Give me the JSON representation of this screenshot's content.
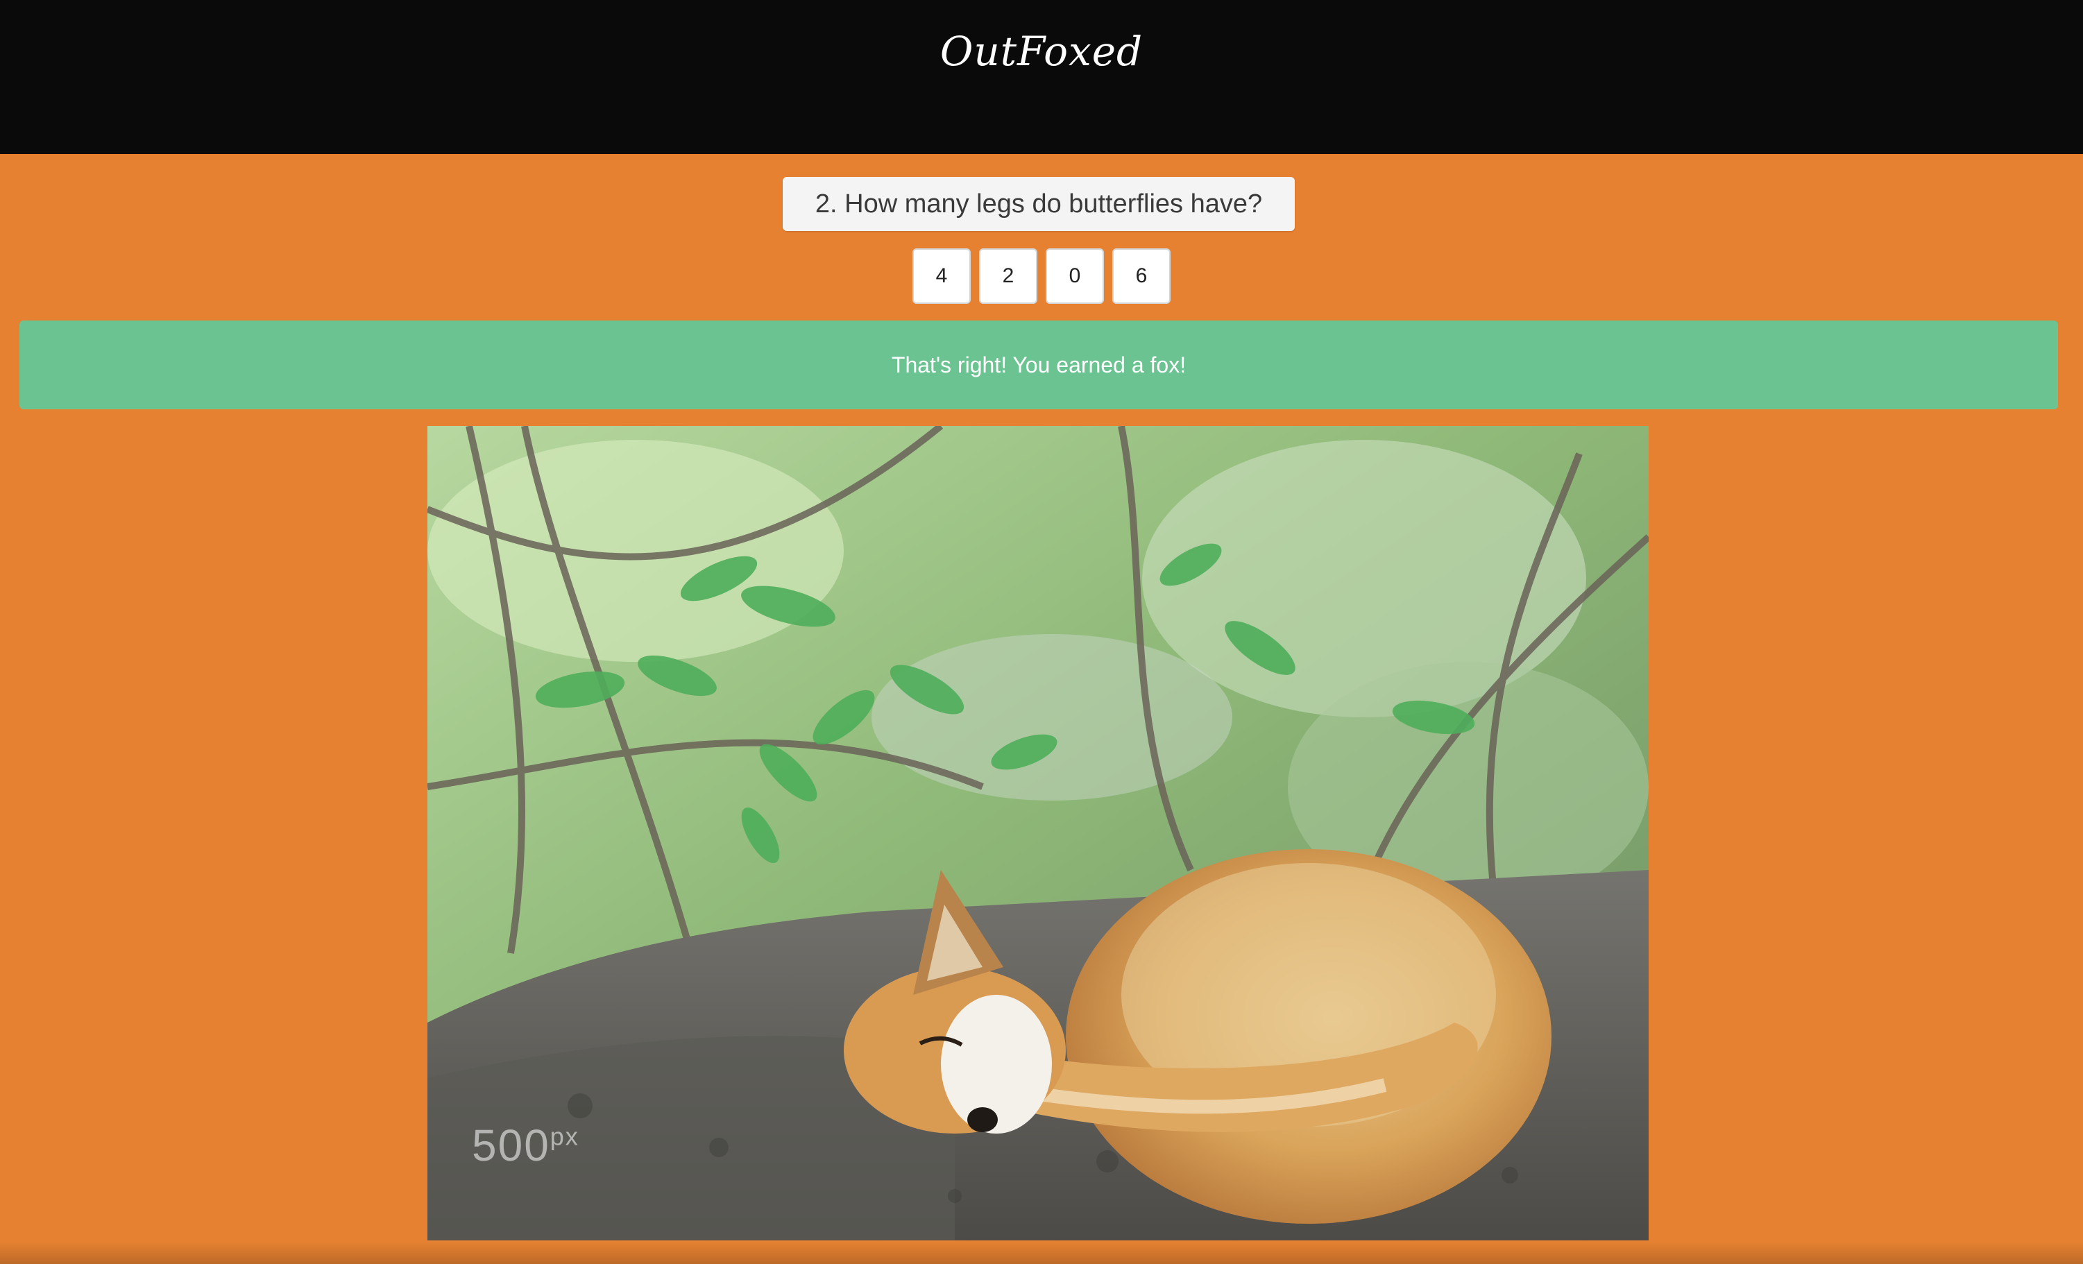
{
  "app": {
    "brand": "OutFoxed"
  },
  "quiz": {
    "question": "2. How many legs do butterflies have?",
    "answers": [
      "4",
      "2",
      "0",
      "6"
    ]
  },
  "feedback": {
    "message": "That's right! You earned a fox!"
  },
  "photo": {
    "watermark_main": "500",
    "watermark_sup": "px"
  },
  "colors": {
    "navbar": "#0a0a0a",
    "page_background": "#e68131",
    "question_background": "#f4f4f4",
    "success_background": "#6bc391"
  }
}
